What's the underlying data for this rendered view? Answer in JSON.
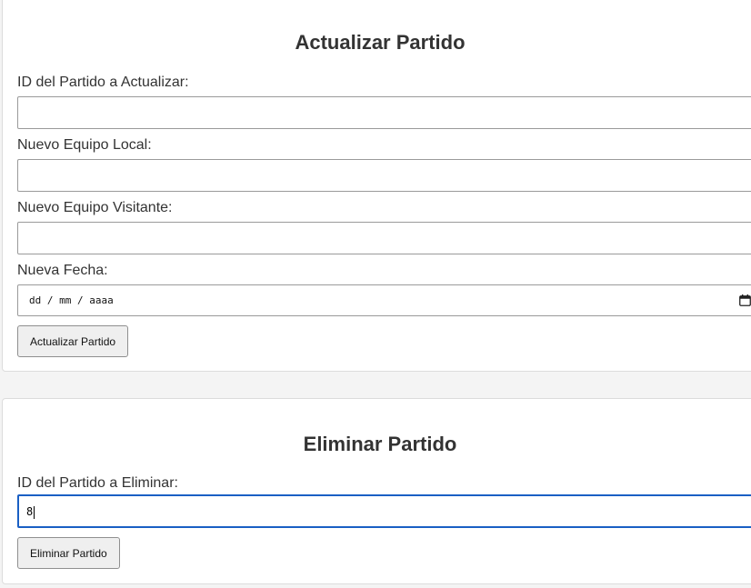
{
  "update_form": {
    "title": "Actualizar Partido",
    "fields": [
      {
        "label": "ID del Partido a Actualizar:",
        "value": ""
      },
      {
        "label": "Nuevo Equipo Local:",
        "value": ""
      },
      {
        "label": "Nuevo Equipo Visitante:",
        "value": ""
      },
      {
        "label": "Nueva Fecha:",
        "placeholder": "dd / mm / aaaa",
        "value": ""
      }
    ],
    "submit_label": "Actualizar Partido"
  },
  "delete_form": {
    "title": "Eliminar Partido",
    "field": {
      "label": "ID del Partido a Eliminar:",
      "value": "8"
    },
    "submit_label": "Eliminar Partido"
  },
  "colors": {
    "page_background": "#f4f4f4",
    "card_background": "#ffffff",
    "focus_border": "#1a5fc4",
    "button_background": "#efefef"
  },
  "icons": {
    "date_picker": "calendar-icon"
  }
}
